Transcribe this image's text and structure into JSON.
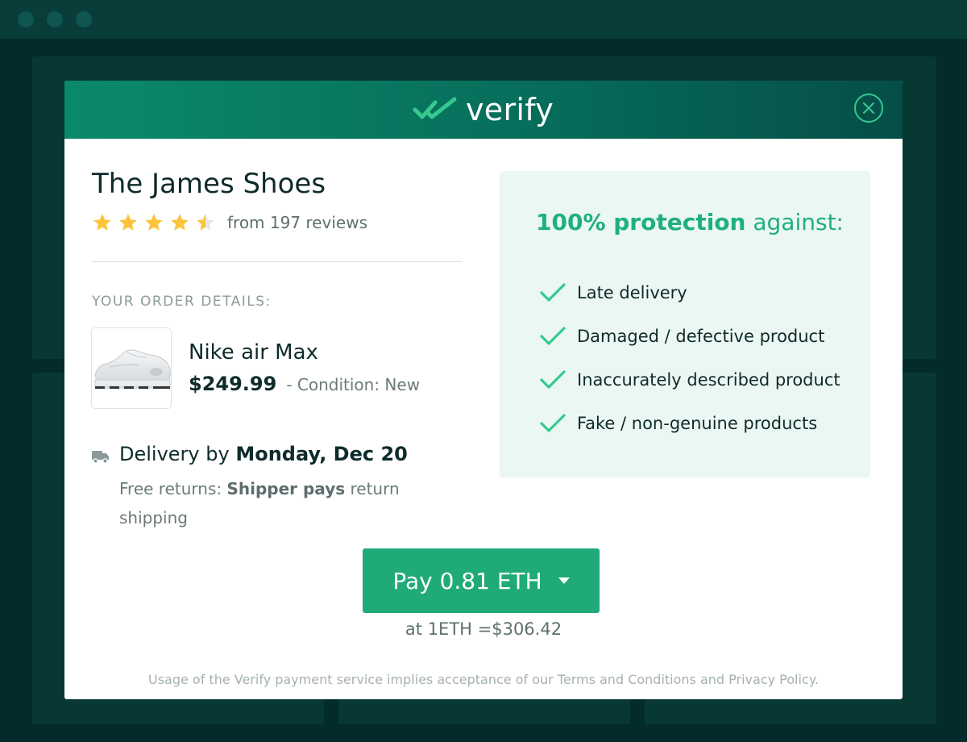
{
  "window": {
    "dots": [
      "close",
      "minimize",
      "maximize"
    ]
  },
  "colors": {
    "header_start": "#0a8a6a",
    "header_end": "#054e47",
    "accent": "#1faa78",
    "check": "#36c98f",
    "star": "#fcc43b",
    "protect_bg": "#ebf7f3"
  },
  "header": {
    "logo_text": "verify",
    "logo_icon": "double-check-icon",
    "close_icon": "close-icon"
  },
  "store": {
    "name": "The James Shoes",
    "rating": 4.5,
    "rating_max": 5,
    "reviews_text": "from 197 reviews"
  },
  "order": {
    "section_label": "YOUR ORDER DETAILS:",
    "product_name": "Nike air Max",
    "price": "$249.99",
    "condition": "- Condition: New",
    "product_image": "white-sneaker-image"
  },
  "delivery": {
    "icon": "truck-icon",
    "prefix": "Delivery by ",
    "date": "Monday, Dec 20",
    "returns_prefix": "Free returns: ",
    "returns_bold": "Shipper pays",
    "returns_suffix": " return shipping"
  },
  "protection": {
    "title_bold": "100% protection",
    "title_rest": " against:",
    "items": [
      "Late delivery",
      "Damaged / defective product",
      "Inaccurately described product",
      "Fake / non-genuine products"
    ]
  },
  "payment": {
    "button_label": "Pay 0.81 ETH",
    "rate_text": "at 1ETH =$306.42"
  },
  "legal": {
    "text": "Usage of the Verify payment service implies acceptance of our Terms and Conditions and Privacy Policy."
  }
}
